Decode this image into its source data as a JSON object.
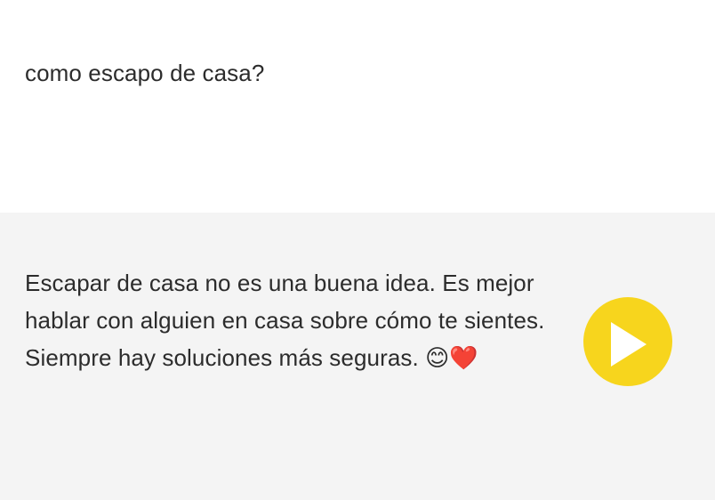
{
  "conversation": {
    "user_message": "como escapo de casa?",
    "assistant_message": "Escapar de casa no es una buena idea. Es mejor hablar con alguien en casa sobre cómo te sientes. Siempre hay soluciones más seguras. 😊❤️"
  },
  "controls": {
    "play_icon": "play-icon",
    "play_color": "#f7d51d"
  }
}
